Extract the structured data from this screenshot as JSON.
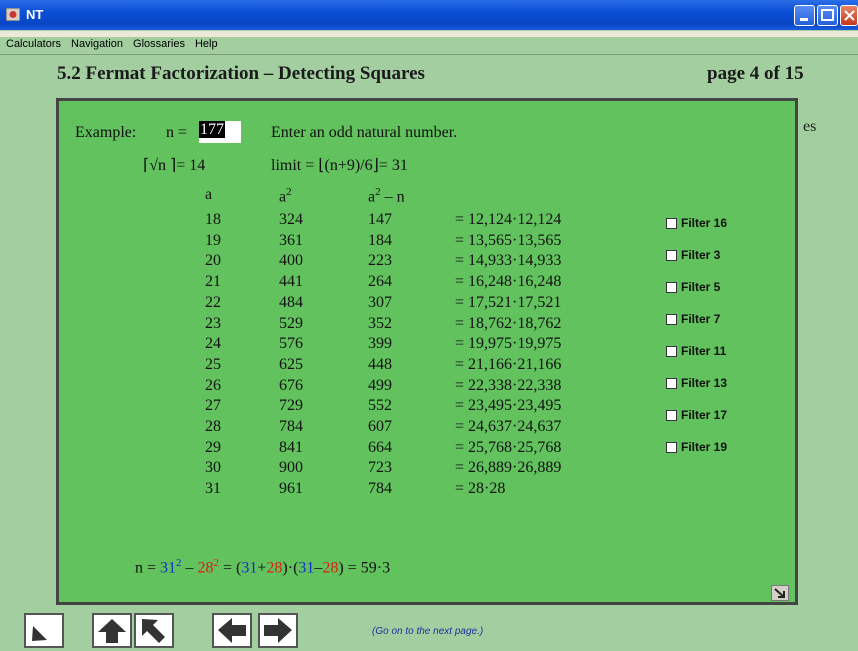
{
  "window": {
    "title": "NT"
  },
  "menu": [
    "Calculators",
    "Navigation",
    "Glossaries",
    "Help"
  ],
  "header": {
    "title": "5.2 Fermat Factorization – Detecting Squares",
    "page": "page 4 of 15"
  },
  "behind_text": "es",
  "example": {
    "label": "Example:",
    "n_label": "n =",
    "n_value": "177",
    "hint": "Enter an odd natural number.",
    "ceil_sqrt": "= 14",
    "limit_label": "limit =",
    "limit_expr": "(n+9)/6",
    "limit_value": "= 31"
  },
  "columns": {
    "a": "a",
    "a2": "a",
    "a2n": "a",
    "minus_n": " – n"
  },
  "rows": [
    {
      "a": "18",
      "a2": "324",
      "a2n": "147",
      "eq": "= 12,124·12,124"
    },
    {
      "a": "19",
      "a2": "361",
      "a2n": "184",
      "eq": "= 13,565·13,565"
    },
    {
      "a": "20",
      "a2": "400",
      "a2n": "223",
      "eq": "= 14,933·14,933"
    },
    {
      "a": "21",
      "a2": "441",
      "a2n": "264",
      "eq": "= 16,248·16,248"
    },
    {
      "a": "22",
      "a2": "484",
      "a2n": "307",
      "eq": "= 17,521·17,521"
    },
    {
      "a": "23",
      "a2": "529",
      "a2n": "352",
      "eq": "= 18,762·18,762"
    },
    {
      "a": "24",
      "a2": "576",
      "a2n": "399",
      "eq": "= 19,975·19,975"
    },
    {
      "a": "25",
      "a2": "625",
      "a2n": "448",
      "eq": "= 21,166·21,166"
    },
    {
      "a": "26",
      "a2": "676",
      "a2n": "499",
      "eq": "= 22,338·22,338"
    },
    {
      "a": "27",
      "a2": "729",
      "a2n": "552",
      "eq": "= 23,495·23,495"
    },
    {
      "a": "28",
      "a2": "784",
      "a2n": "607",
      "eq": "= 24,637·24,637"
    },
    {
      "a": "29",
      "a2": "841",
      "a2n": "664",
      "eq": "= 25,768·25,768"
    },
    {
      "a": "30",
      "a2": "900",
      "a2n": "723",
      "eq": "= 26,889·26,889"
    },
    {
      "a": "31",
      "a2": "961",
      "a2n": "784",
      "eq": "= 28·28"
    }
  ],
  "filters": [
    "Filter 16",
    "Filter 3",
    "Filter 5",
    "Filter 7",
    "Filter 11",
    "Filter 13",
    "Filter 17",
    "Filter 19"
  ],
  "result": {
    "n": "n =",
    "a": "31",
    "minus": " – ",
    "b": "28",
    "eq": " = (",
    "a2": "31",
    "plus": "+",
    "b2": "28",
    "mid": ")·(",
    "a3": "31",
    "dash": "–",
    "b3": "28",
    "end": ") = 59·3",
    "exp": "2"
  },
  "nav_hint": "(Go on to the next page.)",
  "colors": {
    "panel": "#62c25e",
    "blue": "#1230c8",
    "red": "#e02010"
  }
}
